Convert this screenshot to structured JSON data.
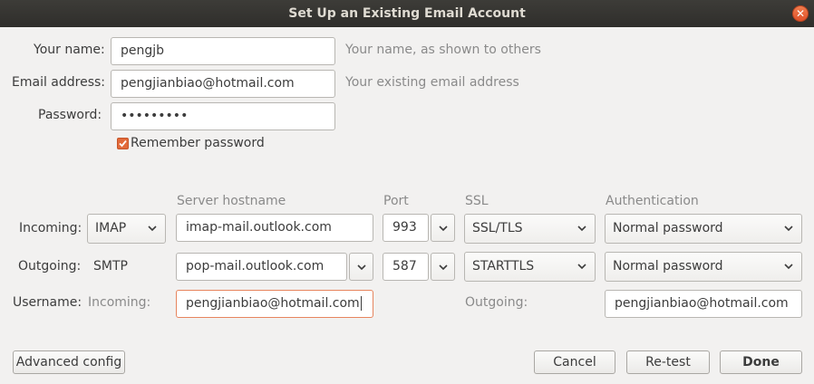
{
  "window": {
    "title": "Set Up an Existing Email Account"
  },
  "identity": {
    "name_label": "Your name:",
    "name_value": "pengjb",
    "name_hint": "Your name, as shown to others",
    "email_label": "Email address:",
    "email_value": "pengjianbiao@hotmail.com",
    "email_hint": "Your existing email address",
    "password_label": "Password:",
    "password_value": "•••••••••",
    "remember_label": "Remember password",
    "remember_checked": true
  },
  "server": {
    "headers": {
      "hostname": "Server hostname",
      "port": "Port",
      "ssl": "SSL",
      "auth": "Authentication"
    },
    "incoming": {
      "label": "Incoming:",
      "protocol": "IMAP",
      "hostname": "imap-mail.outlook.com",
      "port": "993",
      "ssl": "SSL/TLS",
      "auth": "Normal password"
    },
    "outgoing": {
      "label": "Outgoing:",
      "protocol": "SMTP",
      "hostname": "pop-mail.outlook.com",
      "port": "587",
      "ssl": "STARTTLS",
      "auth": "Normal password"
    },
    "username": {
      "label": "Username:",
      "incoming_label": "Incoming:",
      "incoming_value": "pengjianbiao@hotmail.com",
      "outgoing_label": "Outgoing:",
      "outgoing_value": "pengjianbiao@hotmail.com"
    }
  },
  "buttons": {
    "advanced": "Advanced config",
    "cancel": "Cancel",
    "retest": "Re-test",
    "done": "Done"
  },
  "colors": {
    "accent": "#e26a3a",
    "titlebar": "#33322f"
  }
}
